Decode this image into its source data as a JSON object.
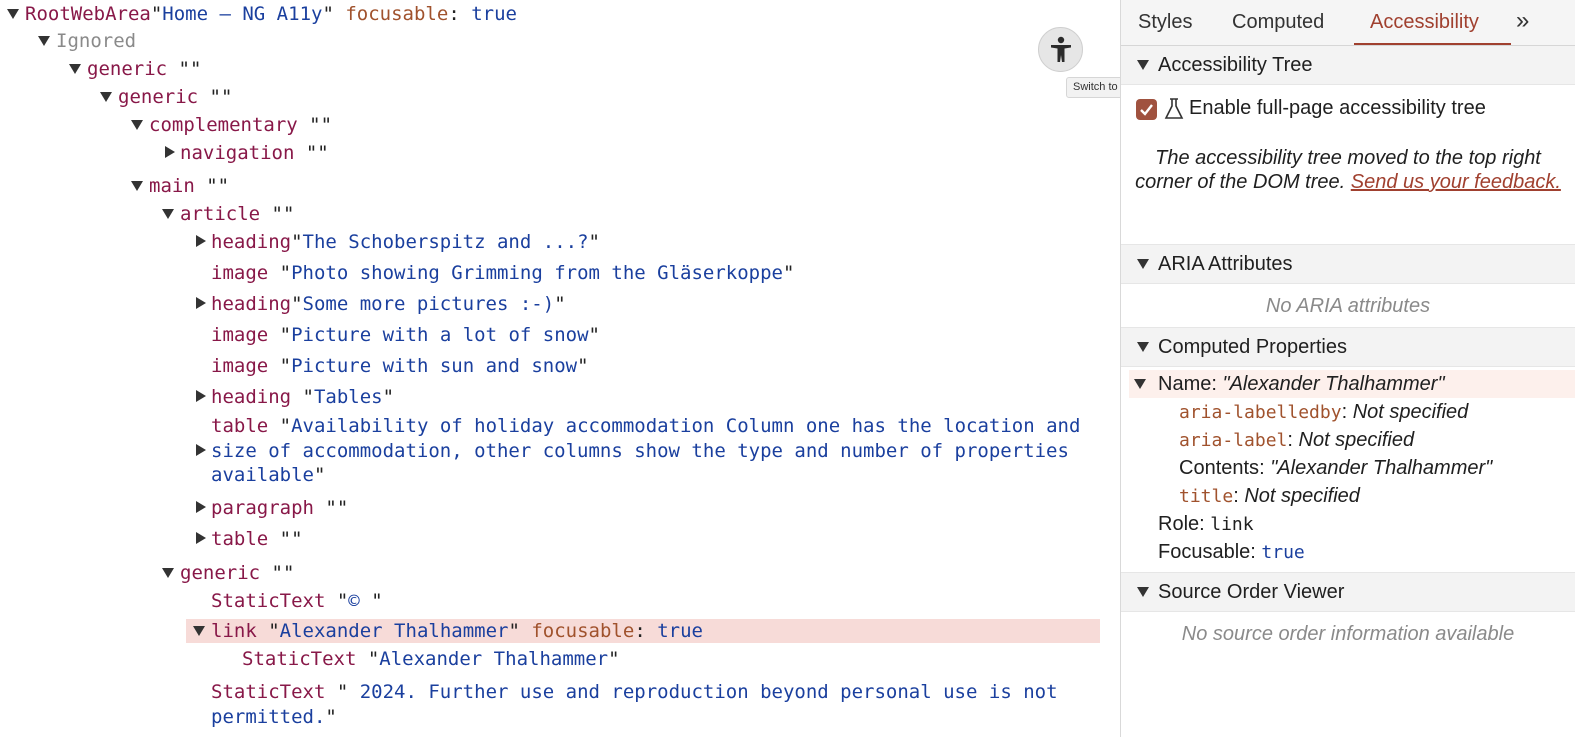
{
  "tree": {
    "root": {
      "role": "RootWebArea",
      "name": "Home – NG A11y",
      "prop": "focusable",
      "val": "true"
    },
    "ignored": "Ignored",
    "rows": [
      {
        "role": "generic",
        "name": ""
      },
      {
        "role": "generic",
        "name": ""
      },
      {
        "role": "complementary",
        "name": ""
      },
      {
        "role": "navigation",
        "name": ""
      },
      {
        "role": "main",
        "name": ""
      },
      {
        "role": "article",
        "name": ""
      },
      {
        "role": "heading",
        "name": "The Schoberspitz and ...?"
      },
      {
        "role": "image",
        "name": "Photo showing Grimming from the Gläserkoppe"
      },
      {
        "role": "heading",
        "name": "Some more pictures :-)"
      },
      {
        "role": "image",
        "name": "Picture with a lot of snow"
      },
      {
        "role": "image",
        "name": "Picture with sun and snow"
      },
      {
        "role": "heading",
        "name": "Tables"
      },
      {
        "role": "table",
        "name": "Availability of holiday accommodation Column one has the location and size of accommodation, other columns show the type and number of properties available"
      },
      {
        "role": "paragraph",
        "name": ""
      },
      {
        "role": "table",
        "name": ""
      },
      {
        "role": "generic",
        "name": ""
      },
      {
        "role": "StaticText",
        "name": "© "
      },
      {
        "role": "link",
        "name": "Alexander Thalhammer",
        "prop": "focusable",
        "val": "true"
      },
      {
        "role": "StaticText",
        "name": "Alexander Thalhammer"
      },
      {
        "role": "StaticText",
        "name": " 2024. Further use and reproduction beyond personal use is not permitted."
      }
    ],
    "toggle_icon": "accessibility-person-icon",
    "tooltip": "Switch to DOM Tree view"
  },
  "sidebar": {
    "tabs": [
      "Styles",
      "Computed",
      "Accessibility"
    ],
    "more_tabs_icon": "chevron-double-right-icon",
    "accessibility_tree": {
      "title": "Accessibility Tree",
      "checkbox_label": "Enable full-page accessibility tree",
      "checkbox_checked": true,
      "experiment_icon": "flask-icon",
      "notice": "The accessibility tree moved to the top right corner of the DOM tree.",
      "feedback_link": "Send us your feedback."
    },
    "aria": {
      "title": "ARIA Attributes",
      "empty": "No ARIA attributes"
    },
    "computed": {
      "title": "Computed Properties",
      "name_label": "Name: ",
      "name_value": "\"Alexander Thalhammer\"",
      "sources": [
        {
          "attr": "aria-labelledby",
          "value": "Not specified"
        },
        {
          "attr": "aria-label",
          "value": "Not specified"
        },
        {
          "label": "Contents",
          "value": "\"Alexander Thalhammer\""
        },
        {
          "attr": "title",
          "value": "Not specified"
        }
      ],
      "role_label": "Role: ",
      "role_value": "link",
      "focusable_label": "Focusable: ",
      "focusable_value": "true"
    },
    "source_order": {
      "title": "Source Order Viewer",
      "empty": "No source order information available"
    }
  }
}
